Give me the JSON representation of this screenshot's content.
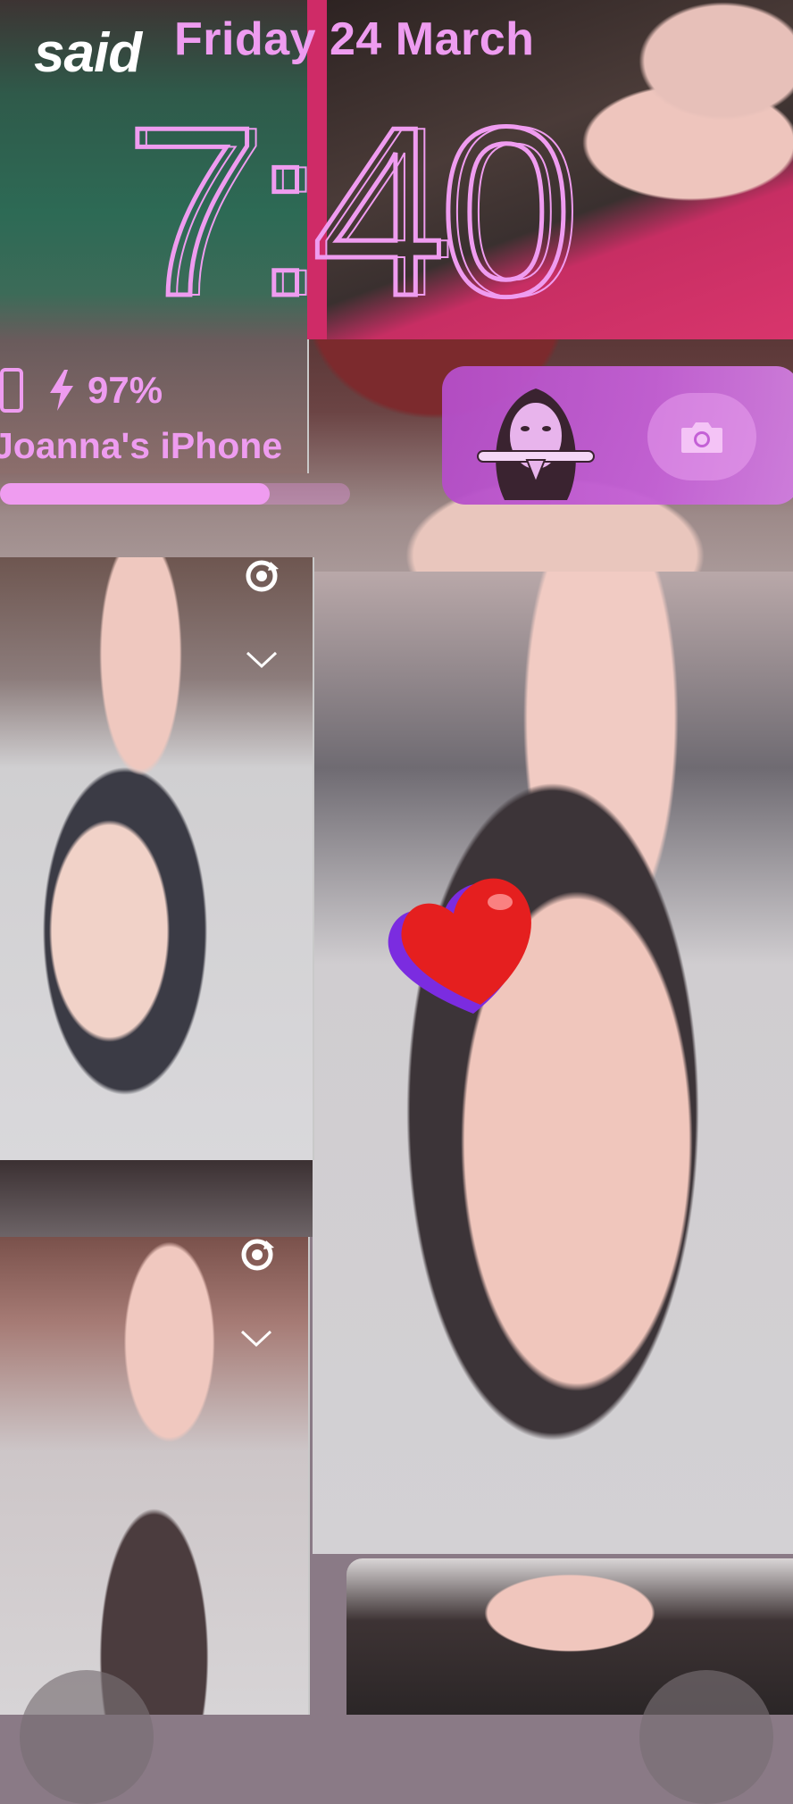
{
  "lockscreen": {
    "date": "Friday 24 March",
    "time": "7:40",
    "battery_percent": "97%",
    "device_name": "Joanna's iPhone",
    "battery_level": 0.77
  },
  "sticker_text": "said",
  "widget": {
    "icon": "camera-icon",
    "avatar": "bitmoji-avatar"
  },
  "icons": {
    "phone": "phone-icon",
    "bolt": "bolt-icon",
    "rotate": "rotate-icon",
    "chevron": "chevron-down-icon",
    "heart": "heart-sticker"
  },
  "colors": {
    "accent": "#ee9cf0",
    "widget": "#c460d6"
  }
}
